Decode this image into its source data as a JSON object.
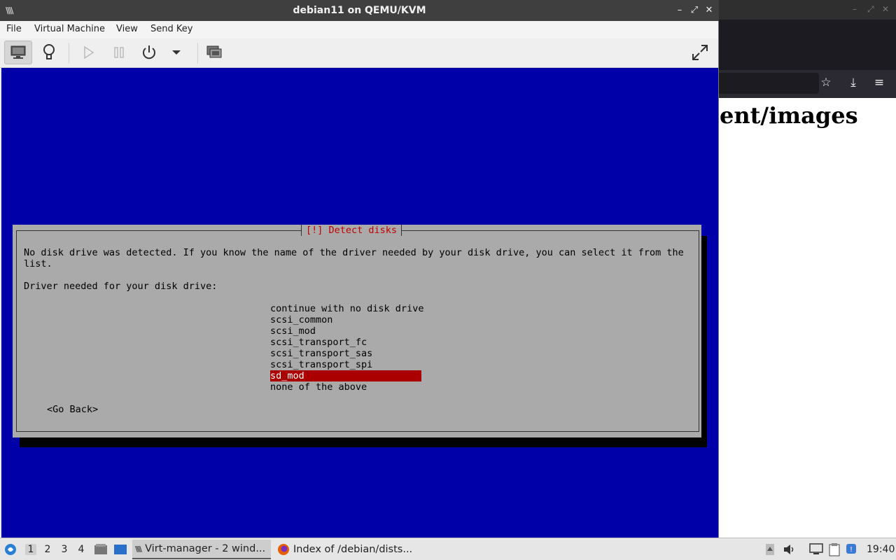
{
  "vm_window": {
    "title": "debian11 on QEMU/KVM",
    "controls": {
      "minimize": "–",
      "maximize": "⤢",
      "close": "✕"
    }
  },
  "menubar": [
    "File",
    "Virtual Machine",
    "View",
    "Send Key"
  ],
  "toolbar": {
    "icons": [
      "monitor-icon",
      "lightbulb-icon",
      "play-icon",
      "pause-icon",
      "power-icon",
      "dropdown-arrow-icon",
      "snapshots-icon",
      "fullscreen-icon"
    ]
  },
  "installer": {
    "dialog_title": "[!] Detect disks",
    "message_line1": "No disk drive was detected. If you know the name of the driver needed by your disk drive, you can select it from the",
    "message_line2": "list.",
    "prompt": "Driver needed for your disk drive:",
    "options": [
      "continue with no disk drive",
      "scsi_common",
      "scsi_mod",
      "scsi_transport_fc",
      "scsi_transport_sas",
      "scsi_transport_spi",
      "sd_mod",
      "none of the above"
    ],
    "selected_option": "sd_mod",
    "go_back": "<Go Back>"
  },
  "background_browser": {
    "heading_fragment": "ent/images"
  },
  "taskbar": {
    "workspaces": [
      "1",
      "2",
      "3",
      "4"
    ],
    "active_workspace": "1",
    "tasks": [
      {
        "label": "Virt-manager - 2 wind...",
        "icon": "virt-manager-icon"
      },
      {
        "label": "Index of /debian/dists...",
        "icon": "firefox-icon"
      }
    ],
    "clock": "19:40"
  },
  "colors": {
    "console_bg": "#0000a8",
    "dialog_bg": "#aaaaaa",
    "dialog_title": "#c00000",
    "selected_bg": "#aa0000"
  }
}
